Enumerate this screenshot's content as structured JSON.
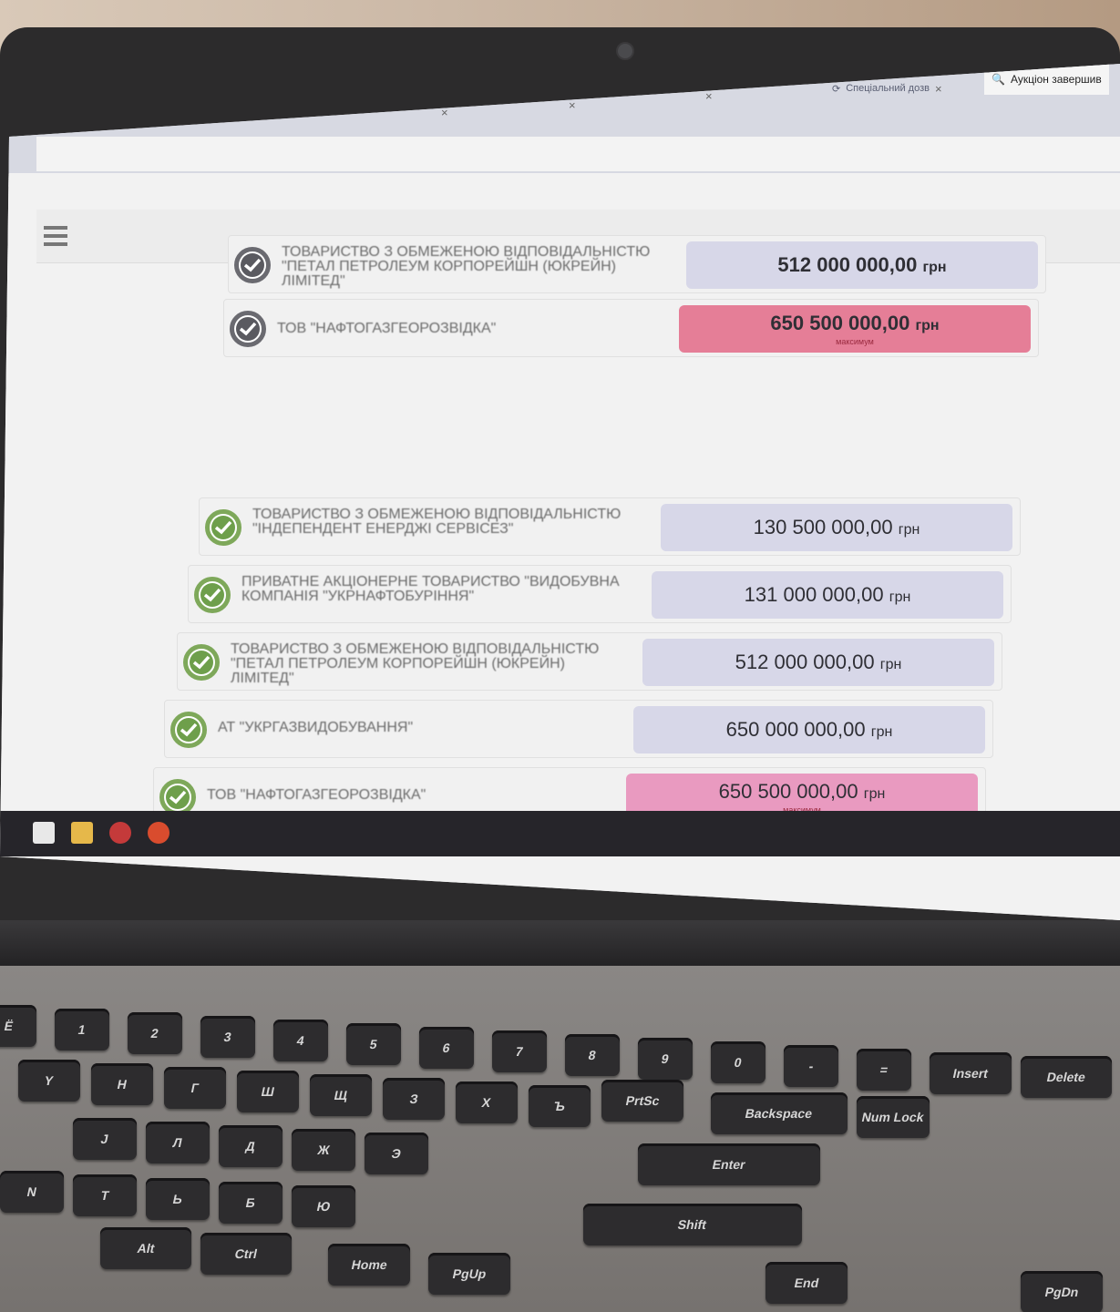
{
  "browser": {
    "tabs": [
      {
        "label": "",
        "active": false
      },
      {
        "label": "",
        "active": false
      },
      {
        "label": "",
        "active": false
      },
      {
        "label": "Спеціальний дозв",
        "active": false
      },
      {
        "label": "Аукціон завершив",
        "active": true
      }
    ],
    "url": ""
  },
  "page": {
    "top_rows": [
      {
        "name": "ТОВАРИСТВО З ОБМЕЖЕНОЮ ВІДПОВІДАЛЬНІСТЮ \"ПЕТАЛ ПЕТРОЛЕУМ КОРПОРЕЙШН (ЮКРЕЙН) ЛІМІТЕД\"",
        "value": "512 000 000,00",
        "currency": "грн",
        "note": "",
        "style": "lav"
      },
      {
        "name": "ТОВ \"НАФТОГАЗГЕОРОЗВІДКА\"",
        "value": "650 500 000,00",
        "currency": "грн",
        "note": "максимум",
        "style": "red"
      }
    ],
    "results_rows": [
      {
        "name": "ТОВАРИСТВО З ОБМЕЖЕНОЮ ВІДПОВІДАЛЬНІСТЮ \"ІНДЕПЕНДЕНТ ЕНЕРДЖІ СЕРВІСЕЗ\"",
        "value": "130 500 000,00",
        "currency": "грн",
        "note": "",
        "style": "lav"
      },
      {
        "name": "ПРИВАТНЕ АКЦІОНЕРНЕ ТОВАРИСТВО \"ВИДОБУВНА КОМПАНІЯ \"УКРНАФТОБУРІННЯ\"",
        "value": "131 000 000,00",
        "currency": "грн",
        "note": "",
        "style": "lav"
      },
      {
        "name": "ТОВАРИСТВО З ОБМЕЖЕНОЮ ВІДПОВІДАЛЬНІСТЮ \"ПЕТАЛ ПЕТРОЛЕУМ КОРПОРЕЙШН (ЮКРЕЙН) ЛІМІТЕД\"",
        "value": "512 000 000,00",
        "currency": "грн",
        "note": "",
        "style": "lav"
      },
      {
        "name": "АТ \"Укргазвидобування\"",
        "value": "650 000 000,00",
        "currency": "грн",
        "note": "",
        "style": "lav"
      },
      {
        "name": "ТОВ \"НАФТОГАЗГЕОРОЗВІДКА\"",
        "value": "650 500 000,00",
        "currency": "грн",
        "note": "максимум",
        "style": "pink"
      }
    ]
  },
  "keyboard": {
    "keys": [
      "Ё",
      "1",
      "2",
      "3",
      "4",
      "5",
      "6",
      "7",
      "8",
      "9",
      "0",
      "-",
      "=",
      "Insert",
      "Delete",
      "Y",
      "Н",
      "Г",
      "Ш",
      "Щ",
      "З",
      "Х",
      "Ъ",
      "Backspace",
      "Num Lock",
      "J",
      "Л",
      "Д",
      "Ж",
      "Э",
      "Enter",
      "Shift",
      "N",
      "Т",
      "Ь",
      "Б",
      "Ю",
      "Alt",
      "Ctrl",
      "Home",
      "PgUp",
      "PrtSc",
      "End",
      "PgDn"
    ]
  },
  "colors": {
    "lavender": "#d7d7e8",
    "pink": "#e99ac0",
    "red": "#e57e97",
    "check_green": "#6e9f4b",
    "check_gray": "#5a5a60"
  }
}
